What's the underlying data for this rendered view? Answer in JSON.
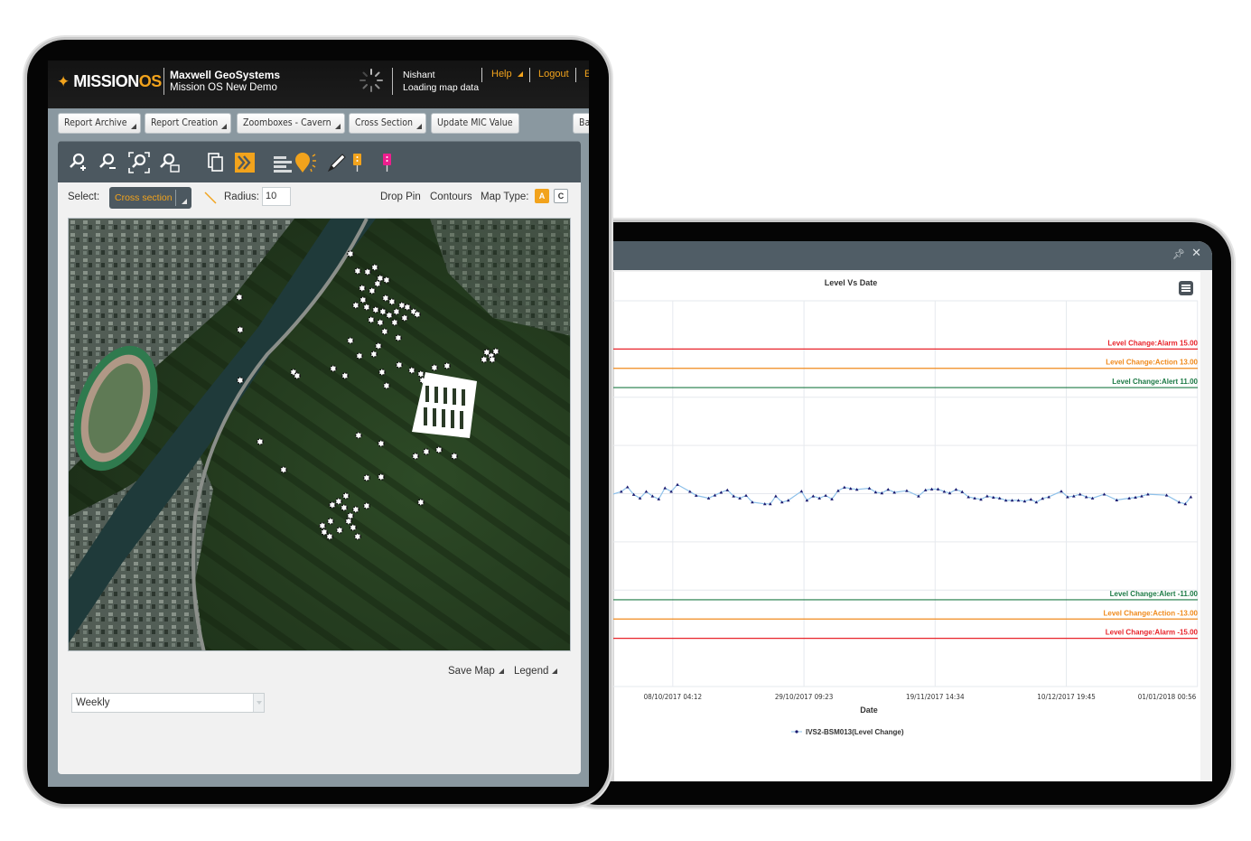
{
  "left_app": {
    "logo": {
      "text_main": "MISSION",
      "text_accent": "OS"
    },
    "company": {
      "name": "Maxwell GeoSystems",
      "project": "Mission OS New Demo"
    },
    "user": {
      "name": "Nishant",
      "status": "Loading map data"
    },
    "header_links": [
      {
        "label": "Help",
        "has_dropdown": true
      },
      {
        "label": "Logout",
        "has_dropdown": false
      },
      {
        "label": "E",
        "has_dropdown": false
      }
    ],
    "top_buttons": [
      {
        "label": "Report Archive",
        "has_dropdown": true
      },
      {
        "label": "Report Creation",
        "has_dropdown": true
      },
      {
        "label": "Zoomboxes - Cavern",
        "has_dropdown": true
      },
      {
        "label": "Cross Section",
        "has_dropdown": true
      },
      {
        "label": "Update MIC Value",
        "has_dropdown": false
      },
      {
        "label": "Ba",
        "has_dropdown": false
      }
    ],
    "toolbar_icons": [
      "zoom-in-icon",
      "zoom-out-icon",
      "zoom-extent-icon",
      "zoom-box-icon",
      "copy-layers-icon",
      "chevron-forward-icon",
      "list-icon",
      "lightbulb-icon",
      "pencil-icon",
      "orange-pin-icon",
      "pink-pin-icon"
    ],
    "select_row": {
      "select_label": "Select:",
      "select_value": "Cross section",
      "radius_label": "Radius:",
      "radius_value": "10",
      "drop_pin": "Drop Pin",
      "contours": "Contours",
      "map_type_label": "Map Type:",
      "map_type_options": [
        "A",
        "C"
      ],
      "map_type_selected": "A"
    },
    "map": {
      "type": "satellite",
      "markers_shown": true
    },
    "footer": {
      "save_map": "Save Map",
      "legend": "Legend",
      "frequency_value": "Weekly"
    },
    "colors": {
      "accent": "#f2a31c",
      "header_bg": "#151515",
      "toolbar_bg": "#4c5860",
      "pink": "#ee1e8e"
    }
  },
  "right_app": {
    "window_icons": [
      "pin-icon",
      "close-icon"
    ],
    "chart_menu_icon": "hamburger-menu-icon"
  },
  "chart_data": {
    "type": "line",
    "title": "Level Vs Date",
    "xlabel": "Date",
    "ylabel": "",
    "ylim": [
      -20,
      20
    ],
    "y_gridlines": [
      -20,
      -10,
      -5,
      0,
      5,
      10,
      20
    ],
    "x_tick_labels": [
      "08/10/2017 04:12",
      "29/10/2017 09:23",
      "19/11/2017 14:34",
      "10/12/2017 19:45",
      "01/01/2018 00:56"
    ],
    "x_tick_days": [
      0,
      21.22,
      42.43,
      63.65,
      84.86
    ],
    "xlim_days": [
      -10.2,
      84.9
    ],
    "x_unit": "days since 08/10/2017 04:12",
    "grid": true,
    "legend": {
      "position": "bottom-center",
      "entries": [
        "IVS2-BSM013(Level Change)"
      ]
    },
    "thresholds": [
      {
        "label": "Level Change:Alarm 15.00",
        "value": 15,
        "color": "#e8232a"
      },
      {
        "label": "Level Change:Action 13.00",
        "value": 13,
        "color": "#f08a1c"
      },
      {
        "label": "Level Change:Alert 11.00",
        "value": 11,
        "color": "#1d7a46"
      },
      {
        "label": "Level Change:Alert -11.00",
        "value": -11,
        "color": "#1d7a46"
      },
      {
        "label": "Level Change:Action -13.00",
        "value": -13,
        "color": "#f08a1c"
      },
      {
        "label": "Level Change:Alarm -15.00",
        "value": -15,
        "color": "#e8232a"
      }
    ],
    "series": [
      {
        "name": "IVS2-BSM013(Level Change)",
        "line_color": "#8ec1ea",
        "marker_color": "#1c1a6e",
        "x": [
          -10.22,
          -8.33,
          -7.32,
          -6.31,
          -5.3,
          -4.29,
          -3.28,
          -2.27,
          -1.26,
          -0.25,
          0.76,
          2.78,
          3.79,
          5.8,
          6.81,
          7.82,
          8.83,
          9.84,
          10.85,
          11.86,
          12.87,
          14.89,
          15.77,
          16.66,
          17.67,
          18.68,
          20.82,
          21.7,
          22.71,
          23.72,
          24.73,
          25.74,
          26.75,
          27.76,
          28.77,
          29.78,
          31.8,
          32.81,
          33.82,
          34.83,
          35.84,
          37.85,
          39.75,
          40.88,
          41.89,
          42.9,
          43.91,
          44.8,
          45.81,
          46.81,
          47.82,
          48.83,
          49.84,
          50.85,
          51.86,
          52.87,
          53.88,
          54.89,
          55.9,
          56.91,
          57.92,
          58.8,
          59.81,
          60.82,
          62.84,
          63.85,
          64.86,
          65.87,
          66.88,
          67.89,
          69.78,
          71.8,
          73.82,
          74.83,
          75.84,
          76.85,
          79.87,
          81.89,
          82.9,
          83.79
        ],
        "y": [
          -0.16,
          0.22,
          0.69,
          -0.09,
          -0.47,
          0.22,
          -0.25,
          -0.56,
          0.59,
          0.22,
          0.94,
          0.22,
          -0.19,
          -0.47,
          -0.16,
          0.13,
          0.38,
          -0.25,
          -0.47,
          -0.19,
          -0.88,
          -1.06,
          -1.06,
          -0.25,
          -0.88,
          -0.69,
          0.25,
          -0.69,
          -0.25,
          -0.47,
          -0.19,
          -0.56,
          0.31,
          0.66,
          0.53,
          0.44,
          0.56,
          0.16,
          0.06,
          0.44,
          0.13,
          0.31,
          -0.25,
          0.38,
          0.47,
          0.47,
          0.22,
          0.06,
          0.44,
          0.19,
          -0.34,
          -0.47,
          -0.59,
          -0.25,
          -0.38,
          -0.47,
          -0.69,
          -0.69,
          -0.69,
          -0.78,
          -0.59,
          -0.88,
          -0.5,
          -0.34,
          0.25,
          -0.34,
          -0.25,
          -0.06,
          -0.34,
          -0.47,
          -0.06,
          -0.66,
          -0.47,
          -0.38,
          -0.25,
          -0.06,
          -0.16,
          -0.88,
          -1.06,
          -0.34
        ]
      }
    ]
  }
}
